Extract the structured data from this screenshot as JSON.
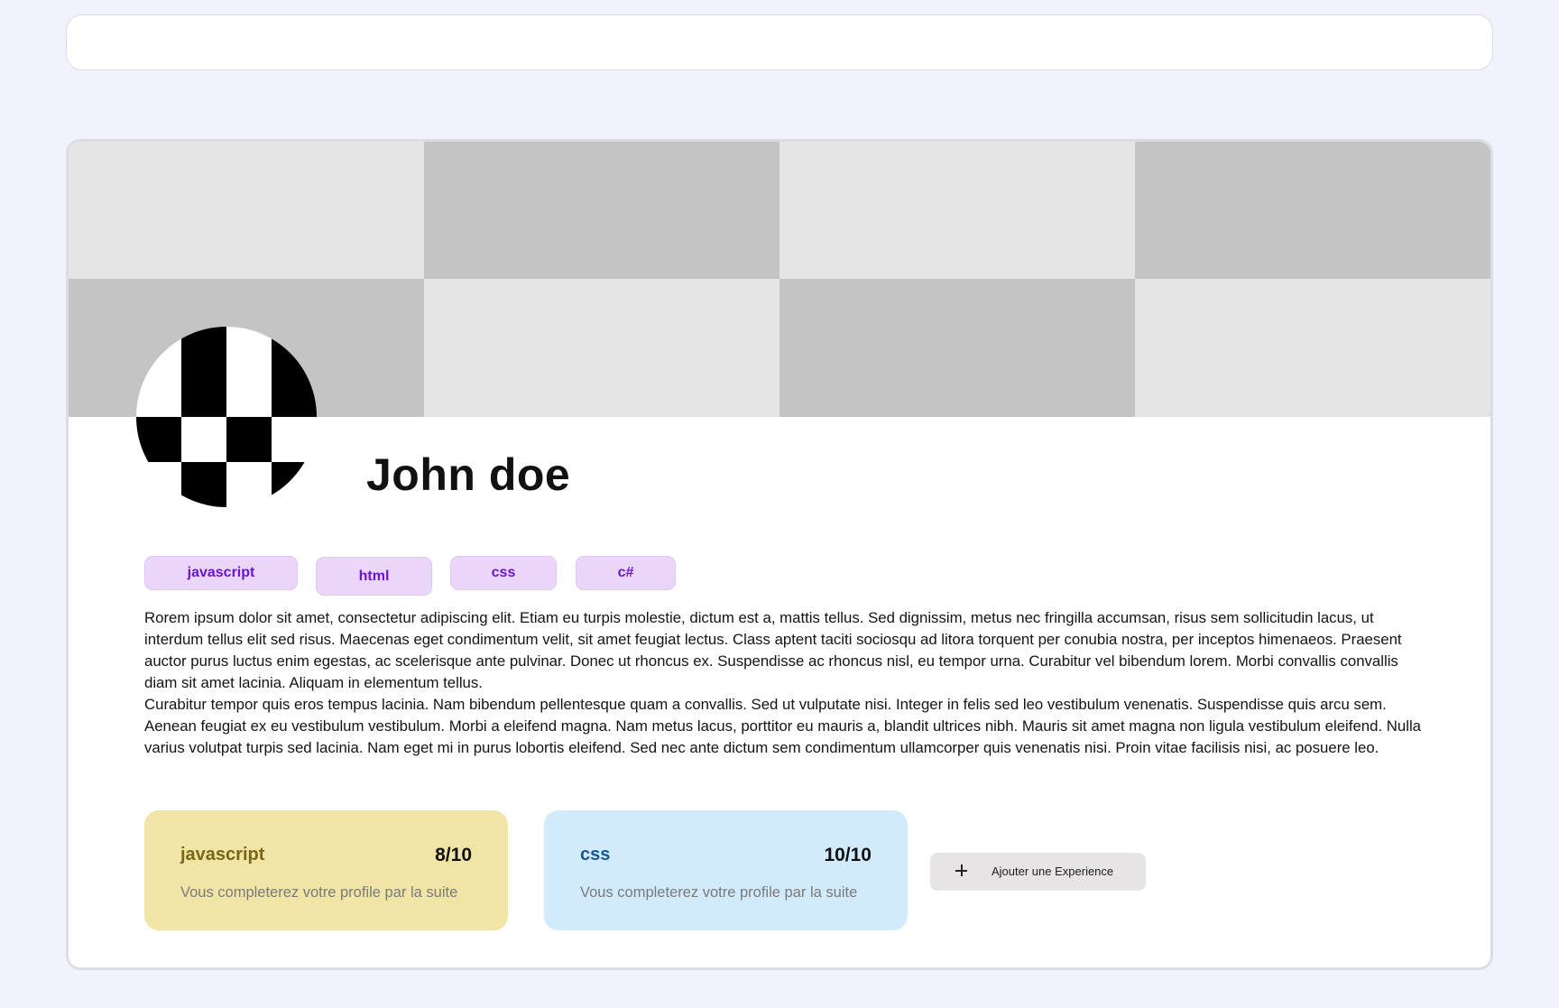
{
  "profile": {
    "name": "John doe",
    "tags": [
      "javascript",
      "html",
      "css",
      "c#"
    ],
    "bio": [
      "Rorem ipsum dolor sit amet, consectetur adipiscing elit. Etiam eu turpis molestie, dictum est a, mattis tellus. Sed dignissim, metus nec fringilla accumsan, risus sem sollicitudin lacus, ut interdum tellus elit sed risus. Maecenas eget condimentum velit, sit amet feugiat lectus. Class aptent taciti sociosqu ad litora torquent per conubia nostra, per inceptos himenaeos. Praesent auctor purus luctus enim egestas, ac scelerisque ante pulvinar. Donec ut rhoncus ex. Suspendisse ac rhoncus nisl, eu tempor urna. Curabitur vel bibendum lorem. Morbi convallis convallis diam sit amet lacinia. Aliquam in elementum tellus.",
      "Curabitur tempor quis eros tempus lacinia. Nam bibendum pellentesque quam a convallis. Sed ut vulputate nisi. Integer in felis sed leo vestibulum venenatis. Suspendisse quis arcu sem. Aenean feugiat ex eu vestibulum vestibulum. Morbi a eleifend magna. Nam metus lacus, porttitor eu mauris a, blandit ultrices nibh. Mauris sit amet magna non ligula vestibulum eleifend. Nulla varius volutpat turpis sed lacinia. Nam eget mi in purus lobortis eleifend. Sed nec ante dictum sem condimentum ullamcorper quis venenatis nisi. Proin vitae facilisis nisi, ac posuere leo."
    ]
  },
  "experiences": [
    {
      "name": "javascript",
      "score": "8/10",
      "description": "Vous completerez votre profile par la suite",
      "background": "#f0e4a6",
      "accent": "#7a6614"
    },
    {
      "name": "css",
      "score": "10/10",
      "description": "Vous completerez votre profile par la suite",
      "background": "#d1eafc",
      "accent": "#125a93"
    }
  ],
  "actions": {
    "add_experience_label": "Ajouter une Experience",
    "add_icon": "plus-icon"
  },
  "colors": {
    "page_background": "#f2f2fd",
    "tag_background": "#ebd6fa",
    "tag_text": "#6a14d6",
    "banner_light": "#e5e5e5",
    "banner_dark": "#c4c4c4"
  }
}
